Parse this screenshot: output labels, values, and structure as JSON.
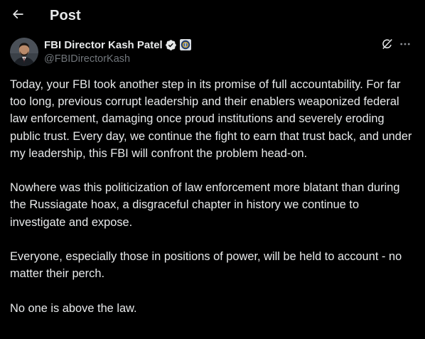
{
  "header": {
    "title": "Post",
    "back_icon": "arrow-left-icon"
  },
  "author": {
    "display_name": "FBI Director Kash Patel",
    "handle": "@FBIDirectorKash",
    "verified_icon": "verified-badge-icon",
    "affiliation_icon": "fbi-seal-icon",
    "verified_color": "#1d9bf0"
  },
  "actions": {
    "grok_icon": "grok-icon",
    "more_icon": "more-horizontal-icon"
  },
  "post": {
    "paragraphs": [
      "Today, your FBI took another step in its promise of full accountability. For far too long, previous corrupt leadership and their enablers weaponized federal law enforcement, damaging once proud institutions and severely eroding public trust. Every day, we continue the fight to earn that trust back, and under my leadership, this FBI will confront the problem head-on.",
      "Nowhere was this politicization of law enforcement more blatant than during the Russiagate hoax, a disgraceful chapter in history we continue to investigate and expose.",
      "Everyone, especially those in positions of power, will be held to account - no matter their perch.",
      "No one is above the law."
    ]
  },
  "colors": {
    "background": "#000000",
    "text_primary": "#e7e9ea",
    "text_secondary": "#71767b"
  }
}
